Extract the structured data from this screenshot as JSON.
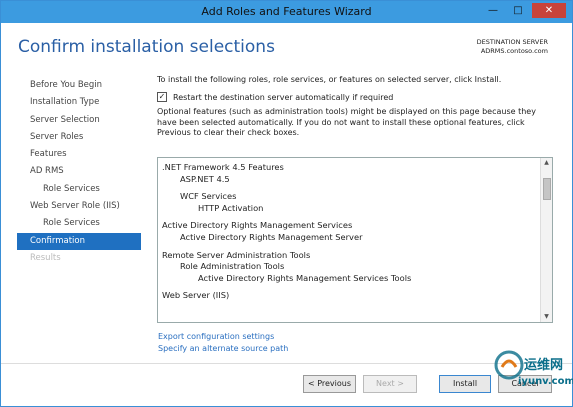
{
  "window": {
    "title": "Add Roles and Features Wizard",
    "controls": [
      "—",
      "□",
      "✕"
    ]
  },
  "header": {
    "title": "Confirm installation selections",
    "destination_label": "DESTINATION SERVER",
    "destination_value": "ADRMS.contoso.com"
  },
  "nav": {
    "items": [
      {
        "label": "Before You Begin",
        "state": "normal"
      },
      {
        "label": "Installation Type",
        "state": "normal"
      },
      {
        "label": "Server Selection",
        "state": "normal"
      },
      {
        "label": "Server Roles",
        "state": "normal"
      },
      {
        "label": "Features",
        "state": "normal"
      },
      {
        "label": "AD RMS",
        "state": "normal"
      },
      {
        "label": "Role Services",
        "state": "sub"
      },
      {
        "label": "Web Server Role (IIS)",
        "state": "normal"
      },
      {
        "label": "Role Services",
        "state": "sub"
      },
      {
        "label": "Confirmation",
        "state": "active"
      },
      {
        "label": "Results",
        "state": "disabled"
      }
    ]
  },
  "content": {
    "intro": "To install the following roles, role services, or features on selected server, click Install.",
    "restart_label": "Restart the destination server automatically if required",
    "restart_checked": true,
    "optional_text": "Optional features (such as administration tools) might be displayed on this page because they have been selected automatically. If you do not want to install these optional features, click Previous to clear their check boxes.",
    "features": {
      "net_framework": ".NET Framework 4.5 Features",
      "aspnet": "ASP.NET 4.5",
      "wcf": "WCF Services",
      "http_activation": "HTTP Activation",
      "adrms": "Active Directory Rights Management Services",
      "adrms_server": "Active Directory Rights Management Server",
      "rsat": "Remote Server Administration Tools",
      "role_admin": "Role Administration Tools",
      "adrms_tools": "Active Directory Rights Management Services Tools",
      "web_server": "Web Server (IIS)"
    },
    "export_link": "Export configuration settings",
    "alt_source_link": "Specify an alternate source path"
  },
  "buttons": {
    "previous": "< Previous",
    "next": "Next >",
    "install": "Install",
    "cancel": "Cancel"
  },
  "watermark": {
    "line1": "运维网",
    "line2": "iyunv.com"
  },
  "colors": {
    "titlebar": "#3c9be0",
    "accent": "#1f70c1",
    "header": "#2a5fa5",
    "link": "#2a6fc0",
    "close": "#c8433a"
  }
}
